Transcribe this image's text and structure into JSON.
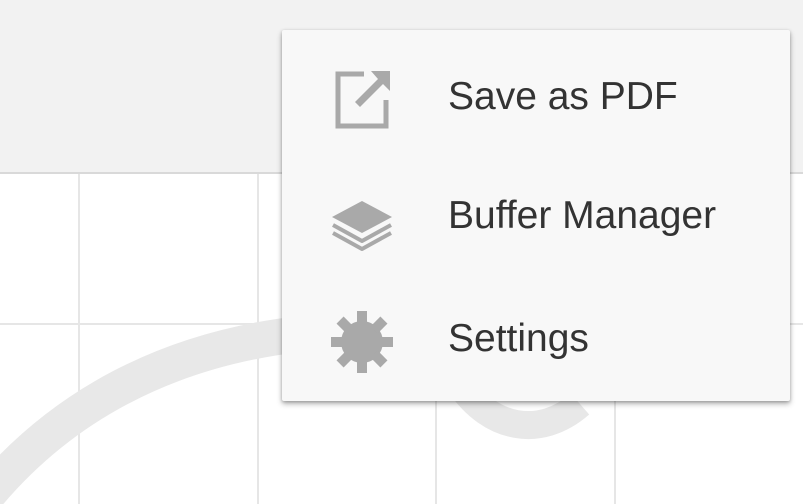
{
  "menu": {
    "items": [
      {
        "label": "Save as PDF",
        "icon": "export-icon"
      },
      {
        "label": "Buffer Manager",
        "icon": "layers-icon"
      },
      {
        "label": "Settings",
        "icon": "gear-icon"
      }
    ]
  },
  "colors": {
    "toolbar_bg": "#f2f2f2",
    "menu_bg": "#f8f8f8",
    "icon": "#a9a9a9",
    "text": "#333333",
    "grid": "#e6e6e6"
  }
}
